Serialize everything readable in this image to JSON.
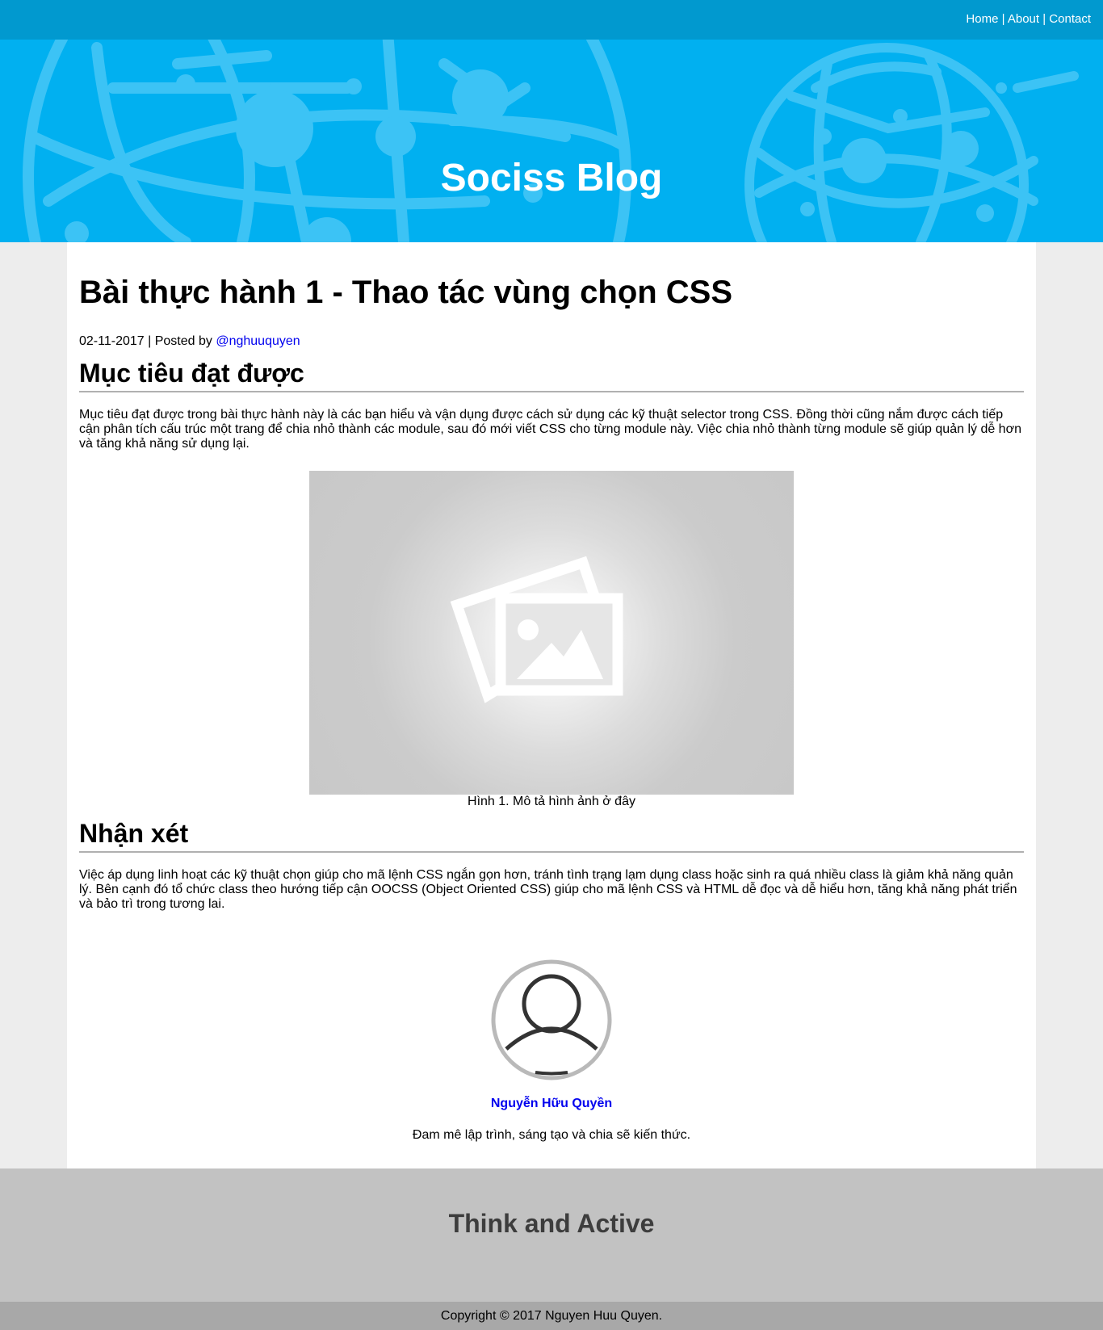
{
  "nav": {
    "items": [
      {
        "label": "Home"
      },
      {
        "label": "About"
      },
      {
        "label": "Contact"
      }
    ],
    "separator": "|"
  },
  "site": {
    "title": "Sociss Blog"
  },
  "colors": {
    "topbar": "#0199cf",
    "hero": "#01b0f0",
    "link": "#0000ee",
    "footer": "#c2c2c2",
    "copyright_bar": "#a8a8a8"
  },
  "post": {
    "title": "Bài thực hành 1 - Thao tác vùng chọn CSS",
    "date": "02-11-2017",
    "posted_by": "| Posted by",
    "author_handle": "@nghuuquyen",
    "sections": [
      {
        "heading": "Mục tiêu đạt được",
        "text": "Mục tiêu đạt được trong bài thực hành này là các bạn hiểu và vận dụng được cách sử dụng các kỹ thuật selector trong CSS. Đồng thời cũng nắm được cách tiếp cận phân tích cấu trúc một trang để chia nhỏ thành các module, sau đó mới viết CSS cho từng module này. Việc chia nhỏ thành từng module sẽ giúp quản lý dễ hơn và tăng khả năng sử dụng lại."
      },
      {
        "heading": "Nhận xét",
        "text": "Việc áp dụng linh hoạt các kỹ thuật chọn giúp cho mã lệnh CSS ngắn gọn hơn, tránh tình trạng lạm dụng class hoặc sinh ra quá nhiều class là giảm khả năng quản lý. Bên cạnh đó tổ chức class theo hướng tiếp cận OOCSS (Object Oriented CSS) giúp cho mã lệnh CSS và HTML dễ đọc và dễ hiểu hơn, tăng khả năng phát triển và bảo trì trong tương lai."
      }
    ],
    "figure": {
      "icon": "image-placeholder-icon",
      "caption": "Hình 1. Mô tả hình ảnh ở đây"
    }
  },
  "author": {
    "avatar_icon": "user-avatar-icon",
    "name": "Nguyễn Hữu Quyền",
    "bio": "Đam mê lập trình, sáng tạo và chia sẽ kiến thức."
  },
  "footer": {
    "slogan": "Think and Active",
    "copyright": "Copyright © 2017 Nguyen Huu Quyen."
  }
}
